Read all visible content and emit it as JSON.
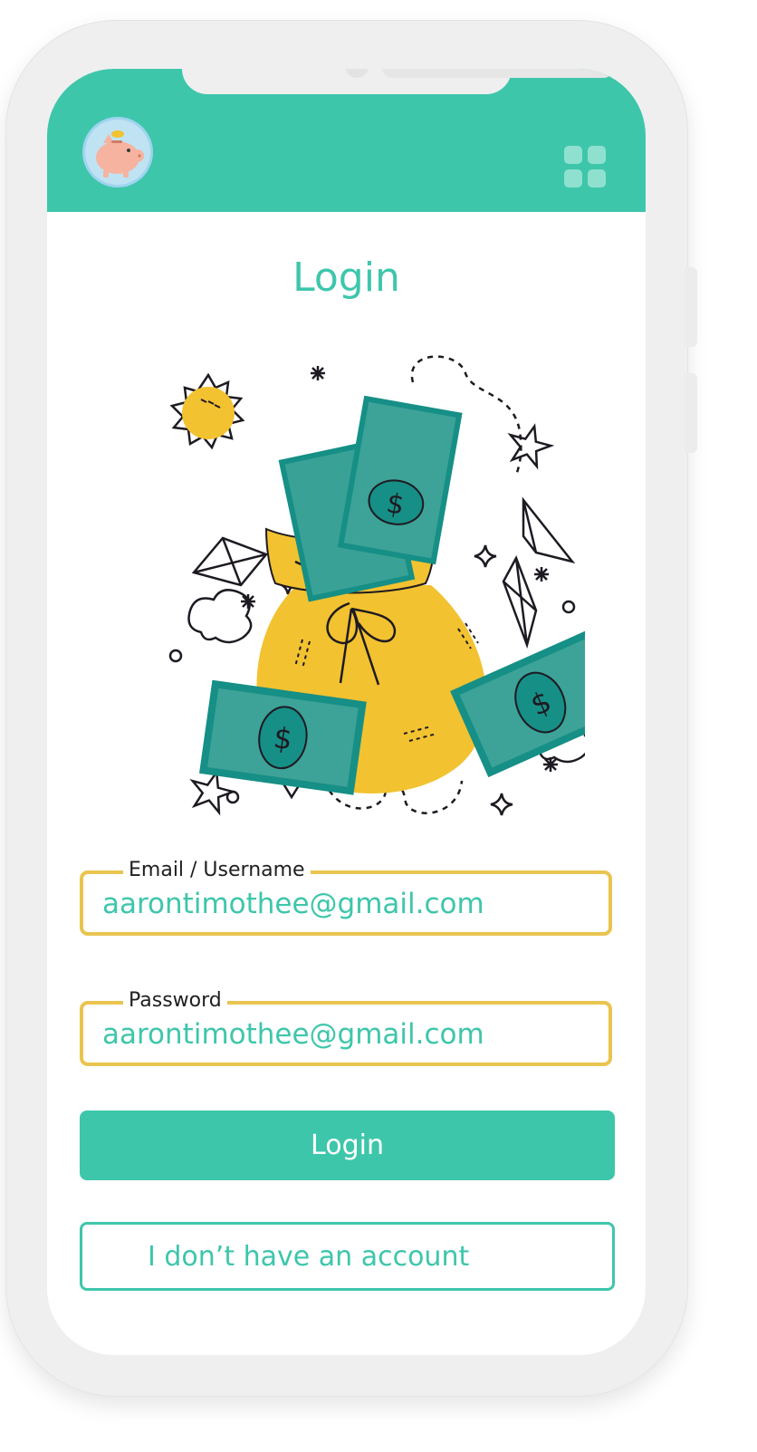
{
  "page": {
    "title": "Login",
    "accent_color": "#3ec6ab",
    "field_border_color": "#e9c44f"
  },
  "header": {
    "avatar_icon": "piggy-bank-icon",
    "menu_icon": "grid-menu-icon"
  },
  "illustration": {
    "subject": "money-bag-with-banknotes"
  },
  "form": {
    "email": {
      "label": "Email / Username",
      "value": "aarontimothee@gmail.com"
    },
    "password": {
      "label": "Password",
      "value": "aarontimothee@gmail.com"
    }
  },
  "buttons": {
    "login_label": "Login",
    "no_account_label": "I don’t have an account"
  }
}
